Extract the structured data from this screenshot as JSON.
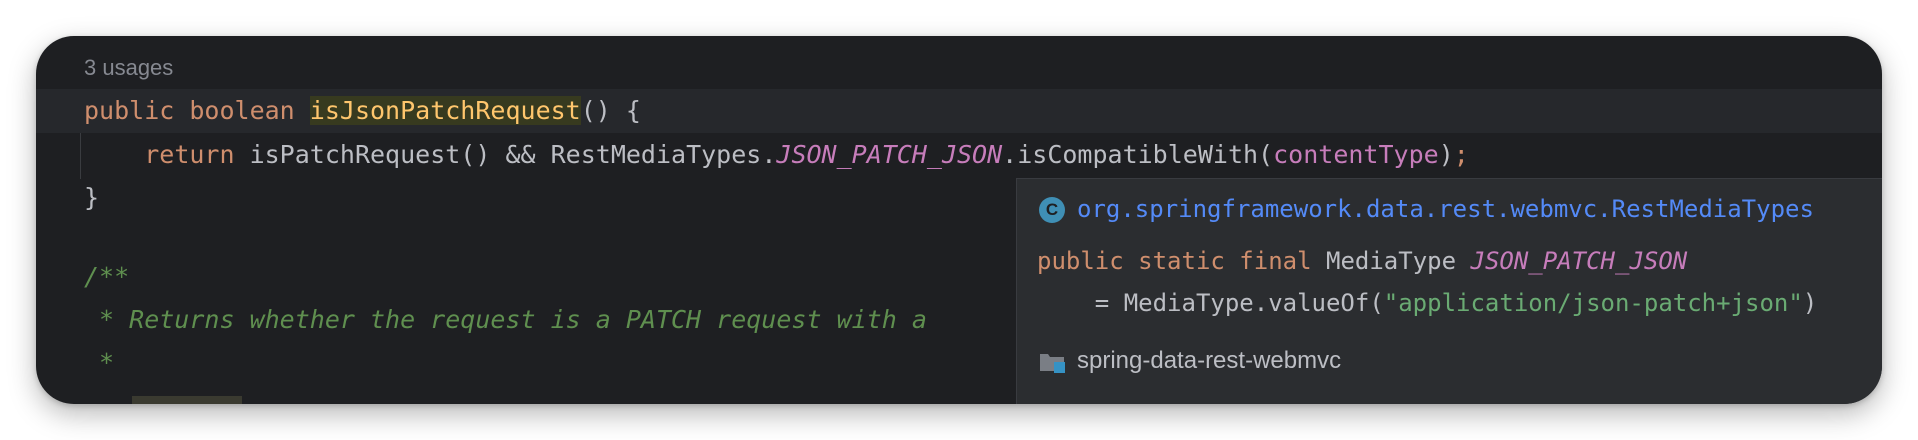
{
  "editor": {
    "usages": "3 usages",
    "method_line": {
      "kw_public": "public",
      "kw_boolean": "boolean",
      "method_name": "isJsonPatchRequest",
      "rest": "() {"
    },
    "return_line": {
      "indent": "    ",
      "kw_return": "return",
      "text1": " isPatchRequest() && RestMediaTypes.",
      "constant": "JSON_PATCH_JSON",
      "text2": ".isCompatibleWith(",
      "param": "contentType",
      "text3": ")",
      "semicolon": ";"
    },
    "closing_brace": "}",
    "comment_start": "/**",
    "comment_line": " * Returns whether the request is a PATCH request with a",
    "comment_star": " *"
  },
  "quick_doc_popup": {
    "class_icon_letter": "C",
    "fully_qualified_name": "org.springframework.data.rest.webmvc.RestMediaTypes",
    "declaration": {
      "modifiers": "public static final",
      "type": "MediaType",
      "name": "JSON_PATCH_JSON",
      "assign": "    = MediaType.valueOf(",
      "string": "\"application/json-patch+json\"",
      "close": ")"
    },
    "module": "spring-data-rest-webmvc"
  },
  "colors": {
    "editor_bg": "#1e1f22",
    "keyword": "#cf8e6d",
    "highlight_fn": "#ffc66d",
    "constant": "#c77dbb",
    "comment": "#5f8f4f",
    "link": "#548af7",
    "string": "#6aab73"
  }
}
